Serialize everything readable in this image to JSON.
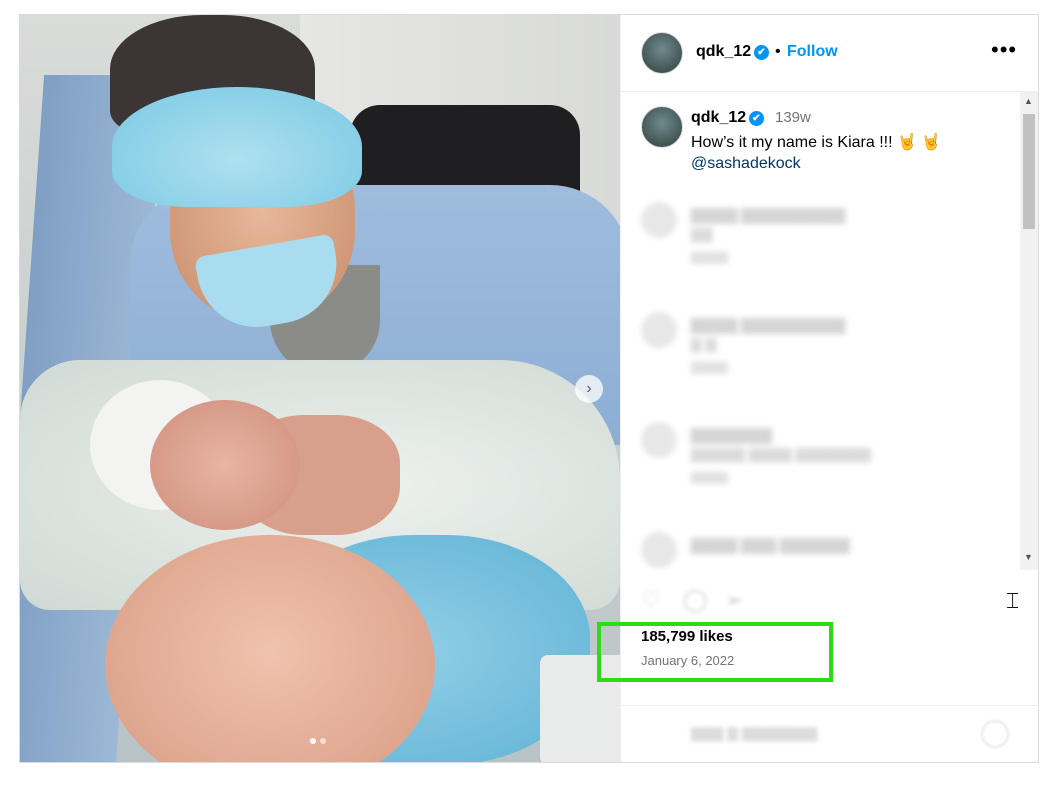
{
  "post": {
    "username": "qdk_12",
    "verified_badge": "✔",
    "separator": "•",
    "follow_label": "Follow",
    "more_label": "•••"
  },
  "carousel": {
    "next_icon": "›",
    "total_slides": 2,
    "active_slide": 1
  },
  "caption": {
    "username": "qdk_12",
    "time": "139w",
    "text": "How’s it my name is Kiara !!! 🤘 🤘",
    "mention": "@sashadekock"
  },
  "engagement": {
    "likes": "185,799 likes",
    "date": "January 6, 2022"
  },
  "icons": {
    "like": "heart-icon",
    "comment": "comment-icon",
    "share": "share-icon",
    "save": "bookmark-icon"
  },
  "colors": {
    "accent": "#0095f6",
    "highlight": "#2bdc12"
  }
}
